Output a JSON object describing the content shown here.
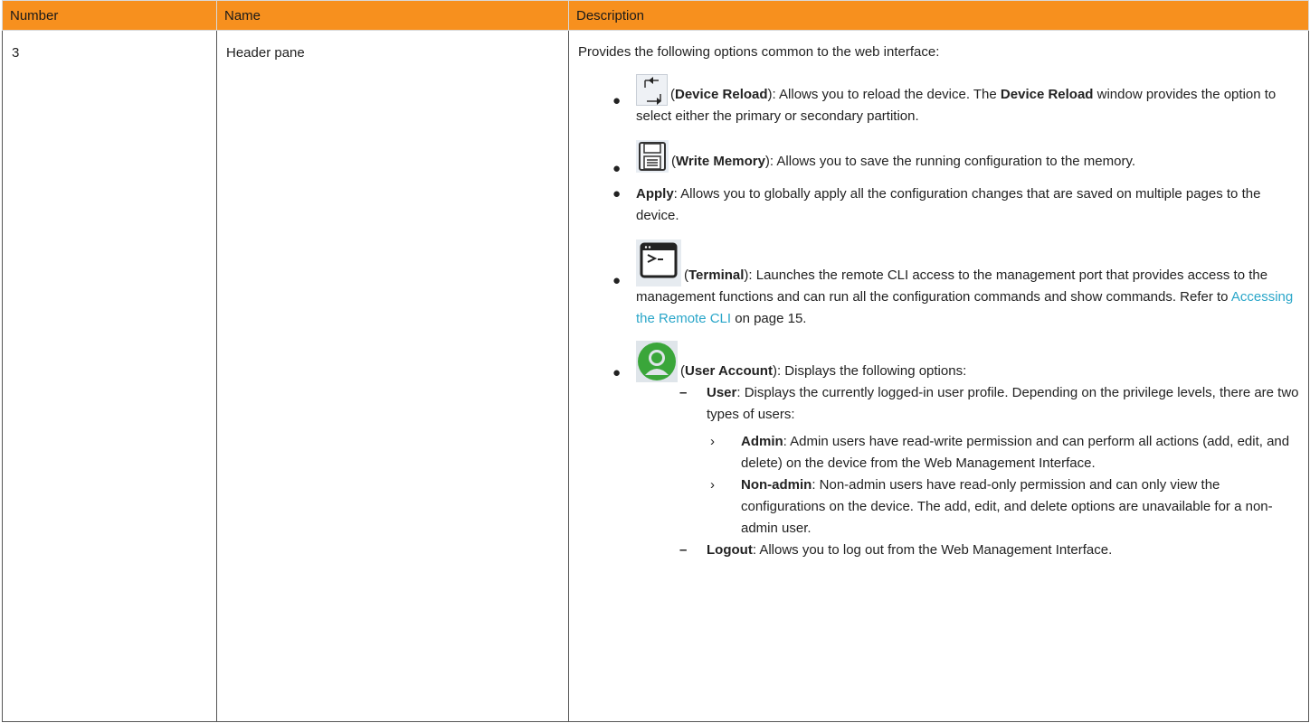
{
  "table": {
    "headers": [
      "Number",
      "Name",
      "Description"
    ],
    "row": {
      "number": "3",
      "name": "Header pane",
      "intro": "Provides the following options common to the web interface:"
    }
  },
  "items": {
    "reload": {
      "icon": "device-reload-icon",
      "open": "(",
      "title": "Device Reload",
      "text1": "): Allows you to reload the device. The ",
      "bold2": "Device Reload",
      "text2": " window provides the option to select either the primary or secondary partition."
    },
    "write": {
      "icon": "save-disk-icon",
      "open": "(",
      "title": "Write Memory",
      "text1": "): Allows you to save the running configuration to the memory."
    },
    "apply": {
      "title": "Apply",
      "text1": ": Allows you to globally apply all the configuration changes that are saved on multiple pages to the device."
    },
    "terminal": {
      "icon": "terminal-icon",
      "open": "(",
      "title": "Terminal",
      "text1": "): Launches the remote CLI access to the management port that provides access to the management functions and can run all the configuration commands and show commands. Refer to ",
      "link": "Accessing the Remote CLI",
      "text2": " on page 15."
    },
    "user_account": {
      "icon": "user-account-icon",
      "open": "(",
      "title": "User Account",
      "text1": "): Displays the following options:",
      "user": {
        "title": "User",
        "text": ": Displays the currently logged-in user profile. Depending on the privilege levels, there are two types of users:"
      },
      "admin": {
        "title": "Admin",
        "text": ": Admin users have read-write permission and can perform all actions (add, edit, and delete) on the device from the Web Management Interface."
      },
      "non_admin": {
        "title": "Non-admin",
        "text": ": Non-admin users have read-only permission and can only view the configurations on the device. The add, edit, and delete options are unavailable for a non-admin user."
      },
      "logout": {
        "title": "Logout",
        "text": ": Allows you to log out from the Web Management Interface."
      }
    }
  },
  "markers": {
    "bullet": "●",
    "dash": "–",
    "chevron": "›"
  },
  "colors": {
    "header_bg": "#f7901e",
    "link": "#2aa6c9",
    "user_icon_green": "#3aa63a"
  }
}
